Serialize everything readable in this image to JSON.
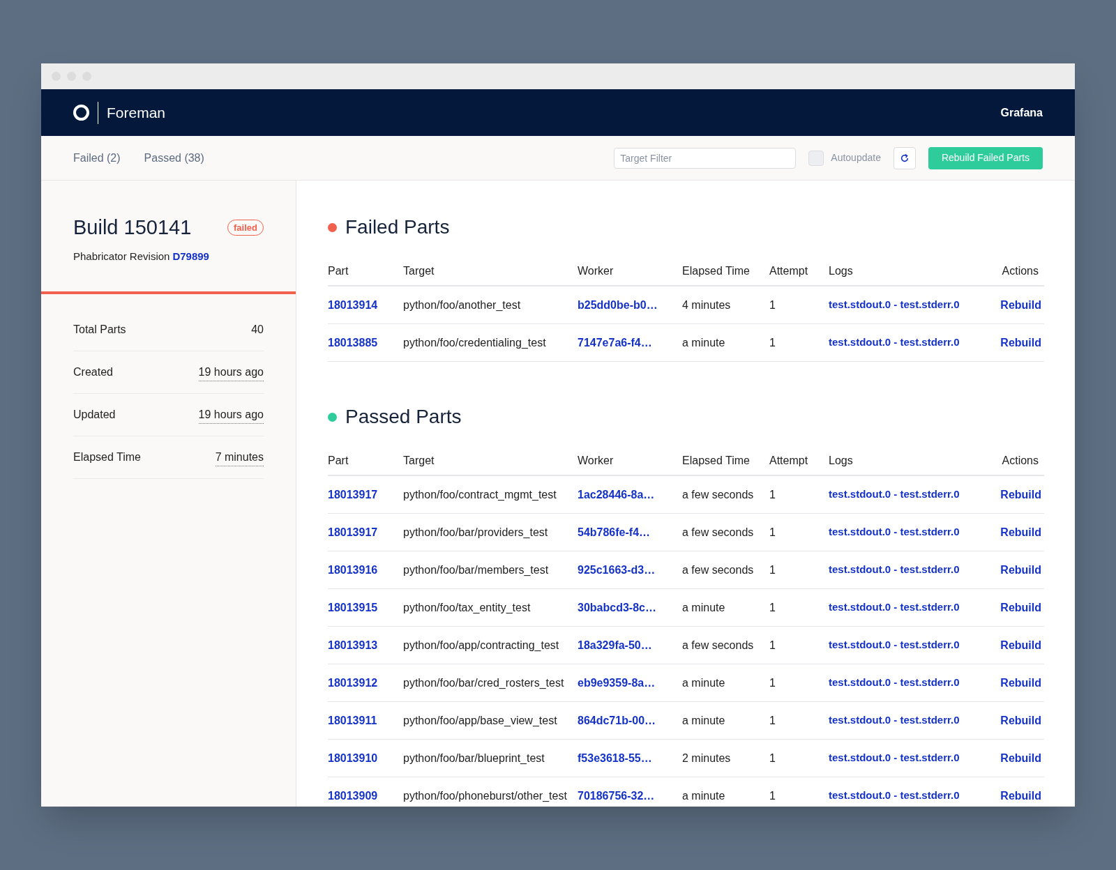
{
  "app": {
    "name": "Foreman",
    "nav_link": "Grafana"
  },
  "tabs": [
    {
      "label": "Failed (2)",
      "selected": false
    },
    {
      "label": "Passed (38)",
      "selected": false
    }
  ],
  "toolbar": {
    "filter": {
      "placeholder": "Target Filter"
    },
    "autoupdate": {
      "label": "Autoupdate",
      "checked": false
    },
    "rebuild_button": "Rebuild Failed Parts"
  },
  "build": {
    "title": "Build 150141",
    "status": "failed",
    "revision_label": "Phabricator Revision",
    "revision": "D79899",
    "stats": [
      {
        "label": "Total Parts",
        "value": "40",
        "dotted": false
      },
      {
        "label": "Created",
        "value": "19 hours ago",
        "dotted": true
      },
      {
        "label": "Updated",
        "value": "19 hours ago",
        "dotted": true
      },
      {
        "label": "Elapsed Time",
        "value": "7 minutes",
        "dotted": true
      }
    ]
  },
  "sections": [
    {
      "title": "Failed Parts",
      "color": "#f0604d",
      "columns": [
        "Part",
        "Target",
        "Worker",
        "Elapsed Time",
        "Attempt",
        "Logs",
        "Actions"
      ],
      "rows": [
        {
          "part": "18013914",
          "target": "python/foo/another_test",
          "worker": "b25dd0be-b0…",
          "elapsed": "4 minutes",
          "attempt": "1",
          "logs": "test.stdout.0 - test.stderr.0",
          "action": "Rebuild"
        },
        {
          "part": "18013885",
          "target": "python/foo/credentialing_test",
          "worker": "7147e7a6-f4…",
          "elapsed": "a minute",
          "attempt": "1",
          "logs": "test.stdout.0 - test.stderr.0",
          "action": "Rebuild"
        }
      ]
    },
    {
      "title": "Passed Parts",
      "color": "#2ecc9a",
      "columns": [
        "Part",
        "Target",
        "Worker",
        "Elapsed Time",
        "Attempt",
        "Logs",
        "Actions"
      ],
      "rows": [
        {
          "part": "18013917",
          "target": "python/foo/contract_mgmt_test",
          "worker": "1ac28446-8a…",
          "elapsed": "a few seconds",
          "attempt": "1",
          "logs": "test.stdout.0 - test.stderr.0",
          "action": "Rebuild"
        },
        {
          "part": "18013917",
          "target": "python/foo/bar/providers_test",
          "worker": "54b786fe-f4…",
          "elapsed": "a few seconds",
          "attempt": "1",
          "logs": "test.stdout.0 - test.stderr.0",
          "action": "Rebuild"
        },
        {
          "part": "18013916",
          "target": "python/foo/bar/members_test",
          "worker": "925c1663-d3…",
          "elapsed": "a few seconds",
          "attempt": "1",
          "logs": "test.stdout.0 - test.stderr.0",
          "action": "Rebuild"
        },
        {
          "part": "18013915",
          "target": "python/foo/tax_entity_test",
          "worker": "30babcd3-8c…",
          "elapsed": "a minute",
          "attempt": "1",
          "logs": "test.stdout.0 - test.stderr.0",
          "action": "Rebuild"
        },
        {
          "part": "18013913",
          "target": "python/foo/app/contracting_test",
          "worker": "18a329fa-50…",
          "elapsed": "a few seconds",
          "attempt": "1",
          "logs": "test.stdout.0 - test.stderr.0",
          "action": "Rebuild"
        },
        {
          "part": "18013912",
          "target": "python/foo/bar/cred_rosters_test",
          "worker": "eb9e9359-8a…",
          "elapsed": "a minute",
          "attempt": "1",
          "logs": "test.stdout.0 - test.stderr.0",
          "action": "Rebuild"
        },
        {
          "part": "18013911",
          "target": "python/foo/app/base_view_test",
          "worker": "864dc71b-00…",
          "elapsed": "a minute",
          "attempt": "1",
          "logs": "test.stdout.0 - test.stderr.0",
          "action": "Rebuild"
        },
        {
          "part": "18013910",
          "target": "python/foo/bar/blueprint_test",
          "worker": "f53e3618-55…",
          "elapsed": "2 minutes",
          "attempt": "1",
          "logs": "test.stdout.0 - test.stderr.0",
          "action": "Rebuild"
        },
        {
          "part": "18013909",
          "target": "python/foo/phoneburst/other_test",
          "worker": "70186756-32…",
          "elapsed": "a minute",
          "attempt": "1",
          "logs": "test.stdout.0 - test.stderr.0",
          "action": "Rebuild"
        }
      ]
    }
  ]
}
